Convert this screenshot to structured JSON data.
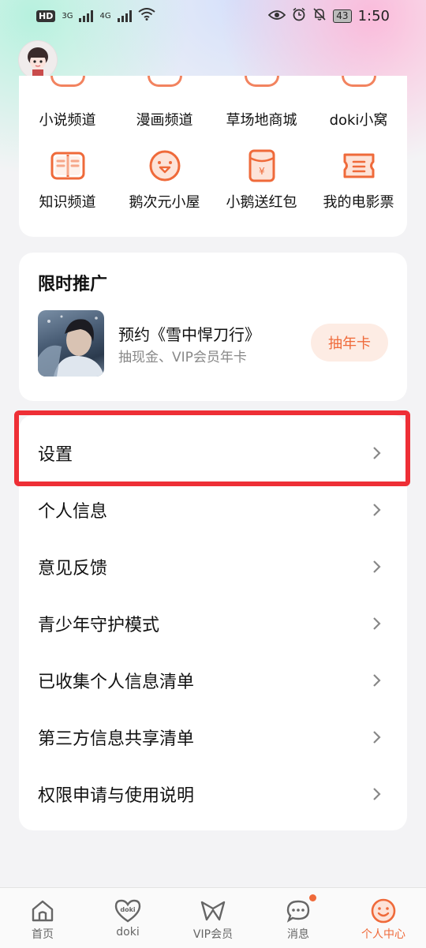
{
  "status_bar": {
    "hd_label": "HD",
    "sim1": "3G",
    "sim2": "4G",
    "battery": "43",
    "time": "1:50"
  },
  "channels_row1": [
    "小说频道",
    "漫画频道",
    "草场地商城",
    "doki小窝"
  ],
  "channels_row2": [
    {
      "label": "知识频道",
      "icon": "book-icon"
    },
    {
      "label": "鹅次元小屋",
      "icon": "penguin-face-icon"
    },
    {
      "label": "小鹅送红包",
      "icon": "red-envelope-icon"
    },
    {
      "label": "我的电影票",
      "icon": "movie-ticket-icon"
    }
  ],
  "promo": {
    "section_title": "限时推广",
    "main_text": "预约《雪中悍刀行》",
    "sub_text": "抽现金、VIP会员年卡",
    "button_label": "抽年卡"
  },
  "menu": [
    "设置",
    "个人信息",
    "意见反馈",
    "青少年守护模式",
    "已收集个人信息清单",
    "第三方信息共享清单",
    "权限申请与使用说明"
  ],
  "highlighted_item": "设置",
  "tabs": [
    {
      "label": "首页",
      "icon": "home-icon"
    },
    {
      "label": "doki",
      "icon": "doki-heart-icon"
    },
    {
      "label": "VIP会员",
      "icon": "vip-bowtie-icon"
    },
    {
      "label": "消息",
      "icon": "message-bubble-icon",
      "badge": true
    },
    {
      "label": "个人中心",
      "icon": "smiley-face-icon",
      "active": true
    }
  ],
  "colors": {
    "accent": "#ef6a3a",
    "highlight_border": "#ee2f36"
  }
}
